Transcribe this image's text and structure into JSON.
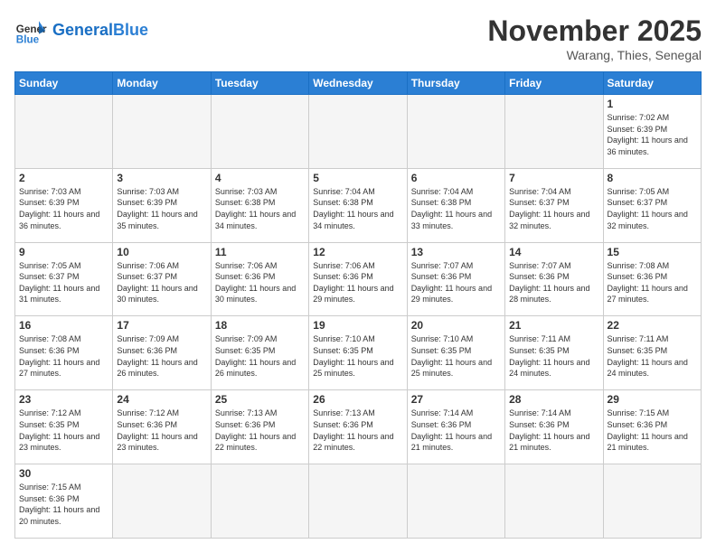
{
  "header": {
    "logo_general": "General",
    "logo_blue": "Blue",
    "month_title": "November 2025",
    "location": "Warang, Thies, Senegal"
  },
  "days_of_week": [
    "Sunday",
    "Monday",
    "Tuesday",
    "Wednesday",
    "Thursday",
    "Friday",
    "Saturday"
  ],
  "weeks": [
    [
      {
        "day": "",
        "empty": true
      },
      {
        "day": "",
        "empty": true
      },
      {
        "day": "",
        "empty": true
      },
      {
        "day": "",
        "empty": true
      },
      {
        "day": "",
        "empty": true
      },
      {
        "day": "",
        "empty": true
      },
      {
        "day": "1",
        "sunrise": "7:02 AM",
        "sunset": "6:39 PM",
        "daylight": "11 hours and 36 minutes."
      }
    ],
    [
      {
        "day": "2",
        "sunrise": "7:03 AM",
        "sunset": "6:39 PM",
        "daylight": "11 hours and 36 minutes."
      },
      {
        "day": "3",
        "sunrise": "7:03 AM",
        "sunset": "6:39 PM",
        "daylight": "11 hours and 35 minutes."
      },
      {
        "day": "4",
        "sunrise": "7:03 AM",
        "sunset": "6:38 PM",
        "daylight": "11 hours and 34 minutes."
      },
      {
        "day": "5",
        "sunrise": "7:04 AM",
        "sunset": "6:38 PM",
        "daylight": "11 hours and 34 minutes."
      },
      {
        "day": "6",
        "sunrise": "7:04 AM",
        "sunset": "6:38 PM",
        "daylight": "11 hours and 33 minutes."
      },
      {
        "day": "7",
        "sunrise": "7:04 AM",
        "sunset": "6:37 PM",
        "daylight": "11 hours and 32 minutes."
      },
      {
        "day": "8",
        "sunrise": "7:05 AM",
        "sunset": "6:37 PM",
        "daylight": "11 hours and 32 minutes."
      }
    ],
    [
      {
        "day": "9",
        "sunrise": "7:05 AM",
        "sunset": "6:37 PM",
        "daylight": "11 hours and 31 minutes."
      },
      {
        "day": "10",
        "sunrise": "7:06 AM",
        "sunset": "6:37 PM",
        "daylight": "11 hours and 30 minutes."
      },
      {
        "day": "11",
        "sunrise": "7:06 AM",
        "sunset": "6:36 PM",
        "daylight": "11 hours and 30 minutes."
      },
      {
        "day": "12",
        "sunrise": "7:06 AM",
        "sunset": "6:36 PM",
        "daylight": "11 hours and 29 minutes."
      },
      {
        "day": "13",
        "sunrise": "7:07 AM",
        "sunset": "6:36 PM",
        "daylight": "11 hours and 29 minutes."
      },
      {
        "day": "14",
        "sunrise": "7:07 AM",
        "sunset": "6:36 PM",
        "daylight": "11 hours and 28 minutes."
      },
      {
        "day": "15",
        "sunrise": "7:08 AM",
        "sunset": "6:36 PM",
        "daylight": "11 hours and 27 minutes."
      }
    ],
    [
      {
        "day": "16",
        "sunrise": "7:08 AM",
        "sunset": "6:36 PM",
        "daylight": "11 hours and 27 minutes."
      },
      {
        "day": "17",
        "sunrise": "7:09 AM",
        "sunset": "6:36 PM",
        "daylight": "11 hours and 26 minutes."
      },
      {
        "day": "18",
        "sunrise": "7:09 AM",
        "sunset": "6:35 PM",
        "daylight": "11 hours and 26 minutes."
      },
      {
        "day": "19",
        "sunrise": "7:10 AM",
        "sunset": "6:35 PM",
        "daylight": "11 hours and 25 minutes."
      },
      {
        "day": "20",
        "sunrise": "7:10 AM",
        "sunset": "6:35 PM",
        "daylight": "11 hours and 25 minutes."
      },
      {
        "day": "21",
        "sunrise": "7:11 AM",
        "sunset": "6:35 PM",
        "daylight": "11 hours and 24 minutes."
      },
      {
        "day": "22",
        "sunrise": "7:11 AM",
        "sunset": "6:35 PM",
        "daylight": "11 hours and 24 minutes."
      }
    ],
    [
      {
        "day": "23",
        "sunrise": "7:12 AM",
        "sunset": "6:35 PM",
        "daylight": "11 hours and 23 minutes."
      },
      {
        "day": "24",
        "sunrise": "7:12 AM",
        "sunset": "6:36 PM",
        "daylight": "11 hours and 23 minutes."
      },
      {
        "day": "25",
        "sunrise": "7:13 AM",
        "sunset": "6:36 PM",
        "daylight": "11 hours and 22 minutes."
      },
      {
        "day": "26",
        "sunrise": "7:13 AM",
        "sunset": "6:36 PM",
        "daylight": "11 hours and 22 minutes."
      },
      {
        "day": "27",
        "sunrise": "7:14 AM",
        "sunset": "6:36 PM",
        "daylight": "11 hours and 21 minutes."
      },
      {
        "day": "28",
        "sunrise": "7:14 AM",
        "sunset": "6:36 PM",
        "daylight": "11 hours and 21 minutes."
      },
      {
        "day": "29",
        "sunrise": "7:15 AM",
        "sunset": "6:36 PM",
        "daylight": "11 hours and 21 minutes."
      }
    ],
    [
      {
        "day": "30",
        "sunrise": "7:15 AM",
        "sunset": "6:36 PM",
        "daylight": "11 hours and 20 minutes."
      },
      {
        "day": "",
        "empty": true
      },
      {
        "day": "",
        "empty": true
      },
      {
        "day": "",
        "empty": true
      },
      {
        "day": "",
        "empty": true
      },
      {
        "day": "",
        "empty": true
      },
      {
        "day": "",
        "empty": true
      }
    ]
  ]
}
